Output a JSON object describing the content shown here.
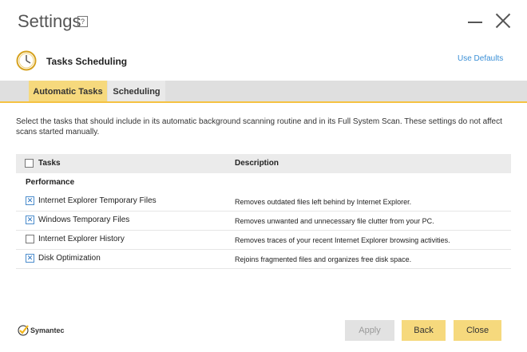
{
  "window": {
    "title": "Settings",
    "help_glyph": "?"
  },
  "section": {
    "title": "Tasks Scheduling",
    "use_defaults": "Use Defaults"
  },
  "tabs": [
    {
      "label": "Automatic Tasks",
      "active": true
    },
    {
      "label": "Scheduling",
      "active": false
    }
  ],
  "intro": "Select the tasks that  should include in its automatic background scanning routine and in its Full System Scan. These settings do not affect scans started manually.",
  "table": {
    "headers": {
      "tasks": "Tasks",
      "description": "Description"
    },
    "select_all_checked": false,
    "group": "Performance",
    "rows": [
      {
        "task": "Internet Explorer Temporary Files",
        "description": "Removes outdated files left behind by Internet Explorer.",
        "checked": true
      },
      {
        "task": "Windows Temporary Files",
        "description": "Removes unwanted and unnecessary file clutter from your PC.",
        "checked": true
      },
      {
        "task": "Internet Explorer History",
        "description": "Removes traces of your recent Internet Explorer browsing activities.",
        "checked": false
      },
      {
        "task": "Disk Optimization",
        "description": "Rejoins fragmented files and organizes free disk space.",
        "checked": true
      }
    ]
  },
  "footer": {
    "brand": "Symantec",
    "apply_label": "Apply",
    "back_label": "Back",
    "close_label": "Close"
  },
  "colors": {
    "accent": "#f6d97d",
    "tab_underline": "#f5c242",
    "link": "#3a8fd6",
    "disabled_button": "#e2e2e2"
  },
  "icons": {
    "window_help": "help-icon",
    "window_minimize": "minimize-icon",
    "window_close": "close-icon",
    "section": "clock-icon",
    "brand": "checkmark-logo-icon"
  }
}
